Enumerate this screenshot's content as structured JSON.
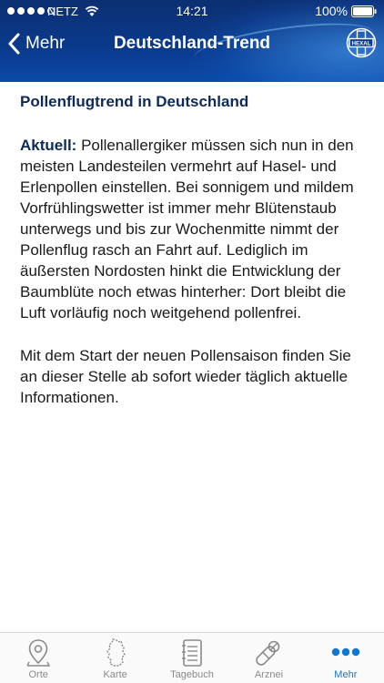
{
  "status_bar": {
    "carrier": "NETZ",
    "time": "14:21",
    "battery": "100%"
  },
  "nav": {
    "back_label": "Mehr",
    "title": "Deutschland-Trend",
    "logo_text": "HEXAL"
  },
  "content": {
    "heading": "Pollenflugtrend in Deutschland",
    "lead": "Aktuell:",
    "paragraph1": " Pollenallergiker müssen sich nun in den meisten Landesteilen vermehrt auf Hasel- und Erlenpollen einstellen. Bei sonnigem und mildem Vorfrühlingswetter ist immer mehr Blütenstaub unterwegs und bis zur Wochenmitte nimmt der Pollenflug rasch an Fahrt auf. Lediglich im äußersten Nordosten hinkt die Entwicklung der Baumblüte noch etwas hinterher: Dort bleibt die Luft vorläufig noch weitgehend pollenfrei.",
    "paragraph2": "Mit dem Start der neuen Pollensaison finden Sie an dieser Stelle ab sofort wieder täglich aktuelle Informationen."
  },
  "tabs": [
    {
      "label": "Orte",
      "icon": "map-pin-icon"
    },
    {
      "label": "Karte",
      "icon": "germany-map-icon"
    },
    {
      "label": "Tagebuch",
      "icon": "notebook-icon"
    },
    {
      "label": "Arznei",
      "icon": "pill-icon"
    },
    {
      "label": "Mehr",
      "icon": "more-dots-icon"
    }
  ],
  "colors": {
    "header": "#0a3a8c",
    "active_tab": "#1277d3",
    "heading": "#0e2a5a"
  }
}
